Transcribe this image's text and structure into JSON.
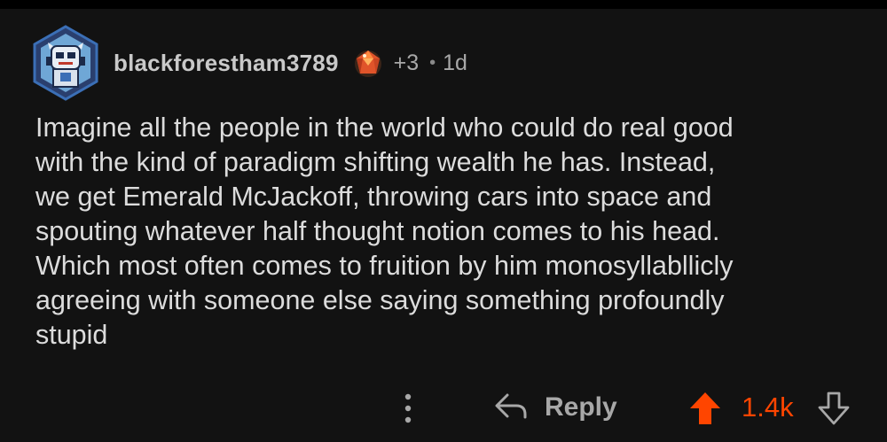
{
  "comment": {
    "author": "blackforestham3789",
    "award_count": "+3",
    "separator": "•",
    "age": "1d",
    "body": "Imagine all the people in the world who could do real good\nwith the kind of paradigm shifting wealth he has. Instead,\nwe get Emerald McJackoff, throwing cars into space and\nspouting whatever half thought notion comes to his head.\nWhich most often comes to fruition by him monosyllabllicly\nagreeing with someone else saying something profoundly\nstupid"
  },
  "actions": {
    "reply_label": "Reply",
    "score": "1.4k",
    "upvoted": true
  },
  "icons": {
    "avatar": "snoo-avatar-robot-hexagon",
    "award": "award-gem-icon",
    "more": "more-vertical-icon",
    "reply": "reply-arrow-icon",
    "upvote": "upvote-arrow-icon",
    "downvote": "downvote-arrow-icon"
  },
  "colors": {
    "background": "#121212",
    "text": "#dcdcdc",
    "muted": "#a8a8a8",
    "accent": "#ff4500",
    "avatar_border": "#3b6fb6"
  }
}
